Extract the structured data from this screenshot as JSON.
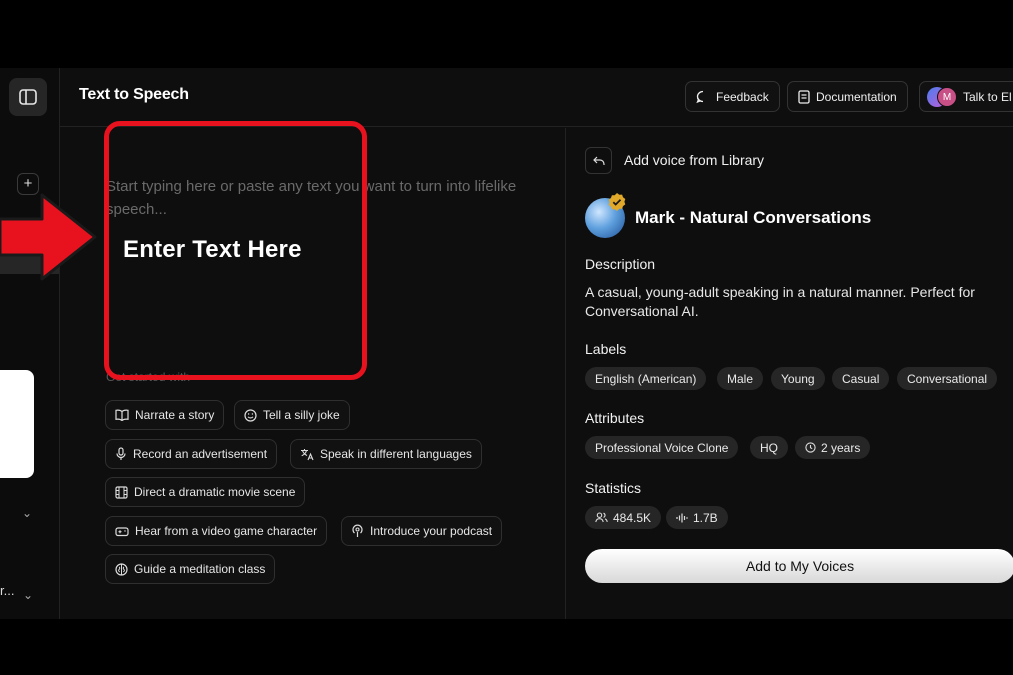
{
  "header": {
    "title": "Text to Speech",
    "feedback_label": "Feedback",
    "documentation_label": "Documentation",
    "talk_label": "Talk to El",
    "avatar_initial": "M"
  },
  "sidebar": {
    "truncated_label": "r...",
    "icons": [
      "sidebar-toggle-icon",
      "plus-icon",
      "chevron-down-icon"
    ]
  },
  "editor": {
    "placeholder": "Start typing here or paste any text you want to turn into lifelike speech...",
    "get_started": "Get started with",
    "suggestions": [
      {
        "label": "Narrate a story",
        "icon": "book-icon"
      },
      {
        "label": "Tell a silly joke",
        "icon": "smile-icon"
      },
      {
        "label": "Record an advertisement",
        "icon": "microphone-icon"
      },
      {
        "label": "Speak in different languages",
        "icon": "translate-icon"
      },
      {
        "label": "Direct a dramatic movie scene",
        "icon": "film-icon"
      },
      {
        "label": "Hear from a video game character",
        "icon": "gamepad-icon"
      },
      {
        "label": "Introduce your podcast",
        "icon": "podcast-icon"
      },
      {
        "label": "Guide a meditation class",
        "icon": "brain-icon"
      }
    ]
  },
  "voice_panel": {
    "back_label": "Add voice from Library",
    "voice_name": "Mark - Natural Conversations",
    "description_heading": "Description",
    "description": "A casual, young-adult speaking in a natural manner. Perfect for Conversational AI.",
    "labels_heading": "Labels",
    "labels": [
      "English (American)",
      "Male",
      "Young",
      "Casual",
      "Conversational"
    ],
    "attributes_heading": "Attributes",
    "attributes": [
      "Professional Voice Clone",
      "HQ",
      "2 years"
    ],
    "statistics_heading": "Statistics",
    "stats": {
      "users": "484.5K",
      "characters": "1.7B"
    },
    "add_button": "Add to My Voices"
  },
  "annotation": {
    "text": "Enter Text Here",
    "color": "#e8121f"
  }
}
